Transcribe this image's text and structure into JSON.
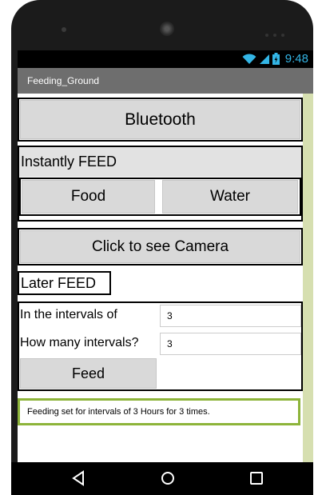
{
  "status_bar": {
    "time": "9:48",
    "icons": [
      "wifi-icon",
      "signal-icon",
      "battery-icon"
    ]
  },
  "title_bar": {
    "title": "Feeding_Ground"
  },
  "bluetooth": {
    "label": "Bluetooth"
  },
  "instant_feed": {
    "label": "Instantly FEED",
    "food_label": "Food",
    "water_label": "Water"
  },
  "camera": {
    "label": "Click to see Camera"
  },
  "later_feed": {
    "label": "Later FEED",
    "intervals_label": "In the intervals of",
    "intervals_value": "3",
    "count_label": "How many intervals?",
    "count_value": "3",
    "feed_label": "Feed"
  },
  "status_message": "Feeding set for intervals of 3 Hours for 3 times.",
  "nav_bar": {
    "icons": [
      "back-icon",
      "home-icon",
      "recents-icon"
    ]
  },
  "colors": {
    "status_accent": "#33b5e5",
    "title_bar": "#6e6e6e",
    "side_strip": "#d6dfb0",
    "message_border": "#8db43a"
  }
}
